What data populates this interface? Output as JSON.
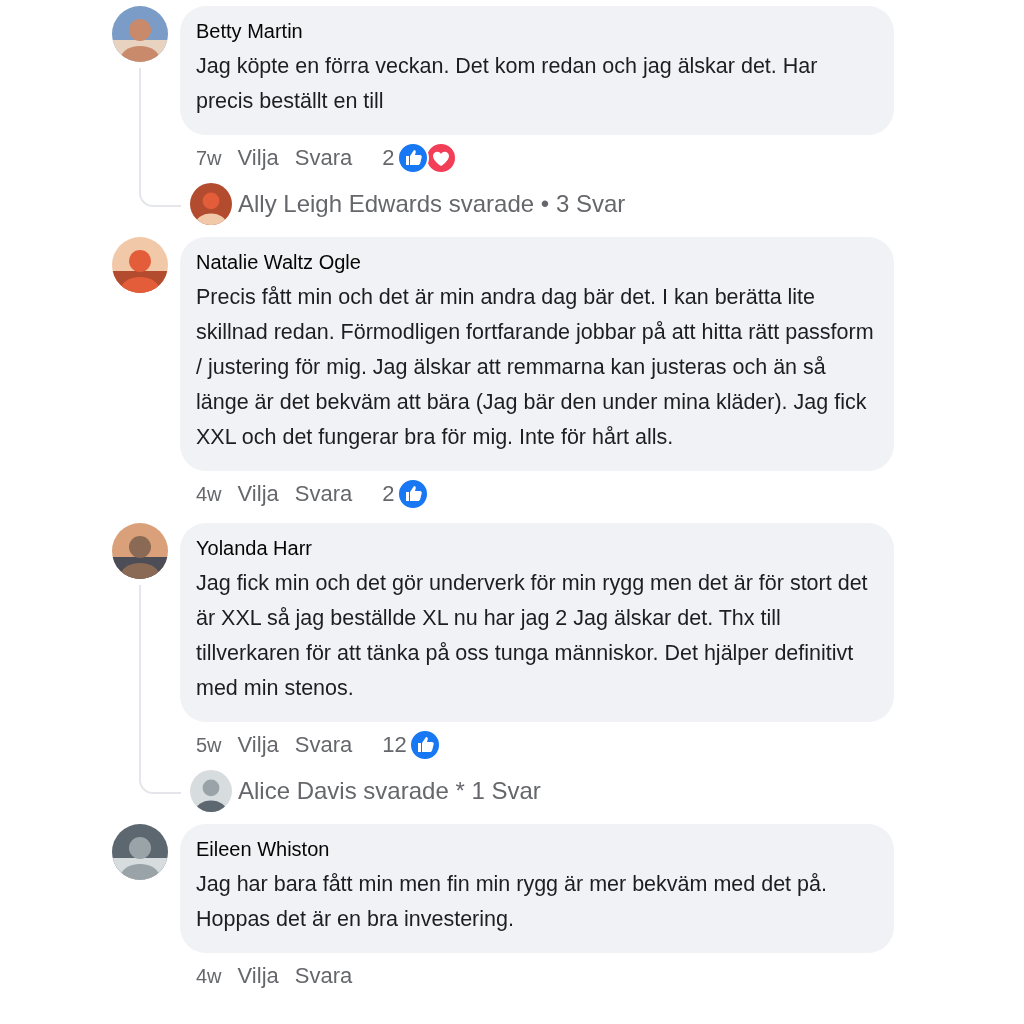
{
  "comments": [
    {
      "author": "Betty Martin",
      "text": "Jag köpte en förra veckan. Det kom redan och jag älskar det. Har precis beställt en till",
      "time": "7w",
      "actions": [
        "Vilja",
        "Svara"
      ],
      "reaction_count": "2",
      "reactions": [
        {
          "kind": "like"
        },
        {
          "kind": "love"
        }
      ],
      "reply_summary": "Ally Leigh Edwards svarade • 3 Svar"
    },
    {
      "author": "Natalie Waltz Ogle",
      "text": "Precis fått min och det är min andra dag bär det. I kan berätta lite skillnad redan. Förmodligen fortfarande jobbar på att hitta rätt passform / justering för mig. Jag älskar att remmarna kan justeras och än så länge är det bekväm att bära (Jag bär den under mina kläder). Jag fick XXL och det fungerar bra för mig. Inte för hårt alls.",
      "time": "4w",
      "actions": [
        "Vilja",
        "Svara"
      ],
      "reaction_count": "2",
      "reactions": [
        {
          "kind": "like"
        }
      ]
    },
    {
      "author": "Yolanda Harr",
      "text": "Jag fick min och det gör underverk för min rygg men det är för stort det är XXL så jag beställde XL nu har jag 2 Jag älskar det. Thx till tillverkaren för att tänka på oss tunga människor. Det hjälper definitivt med min stenos.",
      "time": "5w",
      "actions": [
        "Vilja",
        "Svara"
      ],
      "reaction_count": "12",
      "reactions": [
        {
          "kind": "like"
        }
      ],
      "reply_summary": "Alice Davis svarade * 1 Svar"
    },
    {
      "author": "Eileen Whiston",
      "text": "Jag har bara fått min men fin min rygg är mer bekväm med det på. Hoppas det är en bra investering.",
      "time": "4w",
      "actions": [
        "Vilja",
        "Svara"
      ]
    }
  ]
}
